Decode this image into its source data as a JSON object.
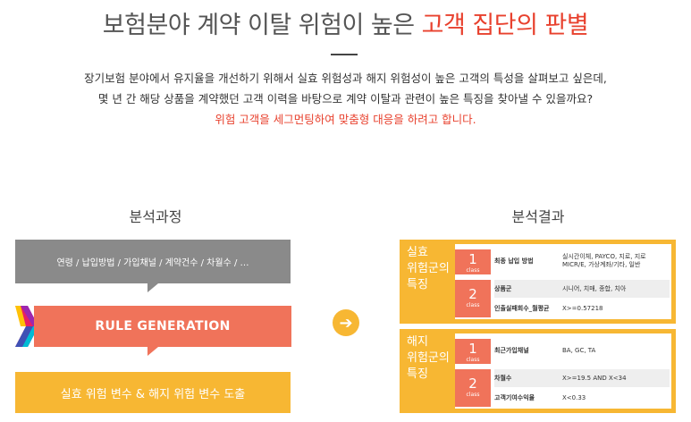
{
  "header": {
    "title_main": "보험분야 계약 이탈 위험이 높은 ",
    "title_highlight": "고객 집단의 판별",
    "intro_line1": "장기보험 분야에서 유지율을 개선하기 위해서 실효 위험성과 해지 위험성이 높은 고객의 특성을 살펴보고 싶은데,",
    "intro_line2": "몇 년 간 해당 상품을 계약했던 고객 이력을 바탕으로 계약 이탈과 관련이 높은 특징을 찾아낼 수 있을까요?",
    "intro_line3": "위험 고객을 세그먼팅하여 맞춤형 대응을 하려고 합니다."
  },
  "process": {
    "title": "분석과정",
    "variables": "연령 / 납입방법 / 가입채널 / 계약건수 / 차월수 / …",
    "rule_label": "RULE GENERATION",
    "output_label": "실효 위험 변수 & 해지 위험 변수 도출"
  },
  "result": {
    "title": "분석결과",
    "groups": [
      {
        "label": "실효\n위험군의\n특징",
        "classes": [
          {
            "num": "1",
            "cls": "class",
            "rows": [
              {
                "k": "최종 납입 방법",
                "v": "실시간이체, PAYCO, 지로, 지로MICR/E, 가상계좌/기타, 일반"
              }
            ]
          },
          {
            "num": "2",
            "cls": "class",
            "rows": [
              {
                "k": "상품군",
                "v": "시니어, 치매, 종합, 치아"
              },
              {
                "k": "인출실패회수_월평균",
                "v": "X>=0.57218"
              }
            ]
          }
        ]
      },
      {
        "label": "해지\n위험군의\n특징",
        "classes": [
          {
            "num": "1",
            "cls": "class",
            "rows": [
              {
                "k": "최근가입채널",
                "v": "BA, GC, TA"
              }
            ]
          },
          {
            "num": "2",
            "cls": "class",
            "rows": [
              {
                "k": "차월수",
                "v": "X>=19.5 AND X<34"
              },
              {
                "k": "고객기여수익율",
                "v": "X<0.33"
              }
            ]
          }
        ]
      }
    ]
  },
  "colors": {
    "accent_red": "#e8412e",
    "orange": "#f0735a",
    "yellow": "#f7b733",
    "gray": "#8a8a8a"
  },
  "icons": {
    "arrow": "arrow-right-circle-icon",
    "chevron": "multicolor-chevron-icon"
  }
}
